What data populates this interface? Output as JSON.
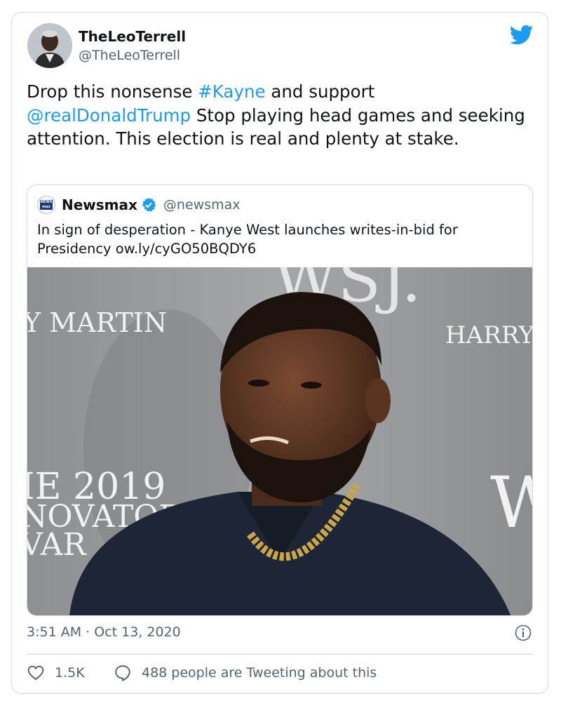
{
  "author": {
    "name": "TheLeoTerrell",
    "handle": "@TheLeoTerrell"
  },
  "tweet": {
    "text_1": "Drop this nonsense ",
    "hashtag": "#Kayne",
    "text_2": " and support ",
    "mention": "@realDonaldTrump",
    "text_3": " Stop playing head games and seeking attention. This election is real and plenty at stake."
  },
  "quoted": {
    "name": "Newsmax",
    "handle": "@newsmax",
    "text": "In sign of desperation - Kanye West launches writes-in-bid for Presidency ow.ly/cyGO50BQDY6",
    "logo_text": "NEWS max",
    "image_text": {
      "left_top": "Y MARTIN",
      "right_top": "HARRY",
      "left_mid_1": "IE 2019",
      "left_mid_2": "NOVATOR",
      "left_mid_3": "VAR",
      "top_center": "WSJ.",
      "right_mid": "W"
    }
  },
  "meta": {
    "time": "3:51 AM",
    "separator": " · ",
    "date": "Oct 13, 2020"
  },
  "stats": {
    "likes": "1.5K",
    "tweeting": "488 people are Tweeting about this"
  },
  "colors": {
    "link": "#1d9bf0",
    "muted": "#536471",
    "border": "#cfd9de"
  },
  "icons": [
    "twitter-bird-icon",
    "verified-badge-icon",
    "info-icon",
    "heart-icon",
    "comment-icon"
  ]
}
